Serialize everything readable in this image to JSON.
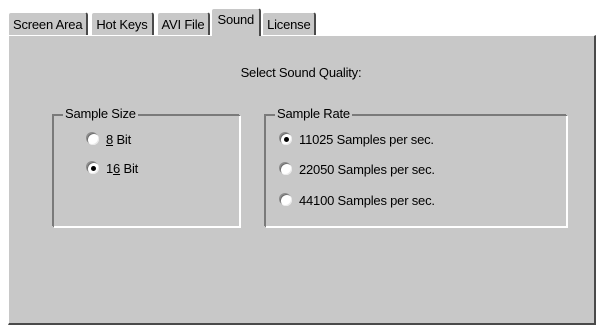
{
  "tabs": [
    {
      "label": "Screen Area",
      "active": false
    },
    {
      "label": "Hot Keys",
      "active": false
    },
    {
      "label": "AVI File",
      "active": false
    },
    {
      "label": "Sound",
      "active": true
    },
    {
      "label": "License",
      "active": false
    }
  ],
  "heading": "Select Sound Quality:",
  "sample_size": {
    "title": "Sample Size",
    "options": [
      {
        "prefix": "",
        "mnemonic": "8",
        "suffix": " Bit",
        "checked": false
      },
      {
        "prefix": "1",
        "mnemonic": "6",
        "suffix": " Bit",
        "checked": true
      }
    ]
  },
  "sample_rate": {
    "title": "Sample Rate",
    "options": [
      {
        "label": "11025 Samples per sec.",
        "checked": true
      },
      {
        "label": "22050 Samples per sec.",
        "checked": false
      },
      {
        "label": "44100 Samples per sec.",
        "checked": false
      }
    ]
  }
}
